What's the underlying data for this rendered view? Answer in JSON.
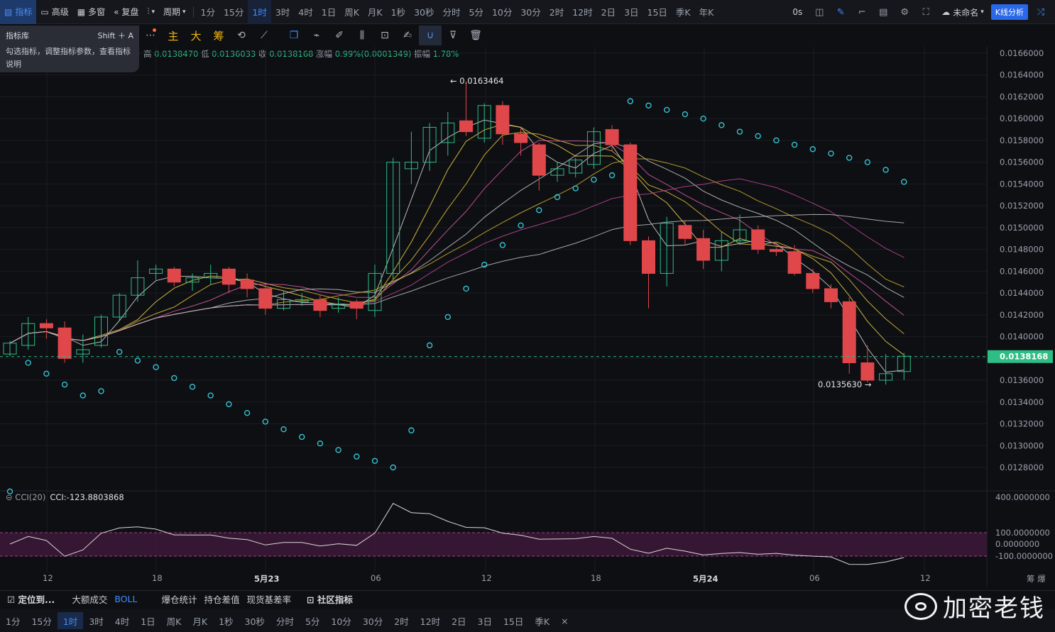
{
  "topbar": {
    "indicator": "指标",
    "advanced": "高级",
    "multi": "多窗",
    "replay": "复盘",
    "period": "周期",
    "timeframes": [
      "1分",
      "15分",
      "1时",
      "3时",
      "4时",
      "1日",
      "周K",
      "月K",
      "1秒",
      "30秒",
      "分时",
      "5分",
      "10分",
      "30分",
      "2时",
      "12时",
      "2日",
      "3日",
      "15日",
      "季K",
      "年K"
    ],
    "active_tf": "1时",
    "countdown": "0s",
    "layout_name": "未命名",
    "kline_btn": "K线分析"
  },
  "popup": {
    "title": "指标库",
    "shortcut": "Shift ＋ A",
    "desc": "勾选指标，调整指标参数，查看指标说明"
  },
  "drawbar": {
    "chars": [
      "主",
      "大",
      "筹"
    ]
  },
  "ohlc": {
    "high_label": "高",
    "high": "0.0138470",
    "low_label": "低",
    "low": "0.0136033",
    "close_label": "收",
    "close": "0.0138168",
    "chg_label": "涨幅",
    "chg": "0.99%(0.0001349)",
    "amp_label": "振幅",
    "amp": "1.78%"
  },
  "cci": {
    "label": "CCI(20)",
    "value": "CCI:-123.8803868"
  },
  "annotations": {
    "max": "← 0.0163464",
    "min": "0.0135630 →",
    "last_price": "0.0138168"
  },
  "colors": {
    "up": "#2dbd85",
    "down": "#e0474a",
    "bg": "#0e0f13",
    "accent": "#3f8cff",
    "sar": "#35c3d0",
    "last": "#2dbd85"
  },
  "chart_data": {
    "type": "candlestick",
    "price_ticks": [
      "0.0166000",
      "0.0164000",
      "0.0162000",
      "0.0160000",
      "0.0158000",
      "0.0156000",
      "0.0154000",
      "0.0152000",
      "0.0150000",
      "0.0148000",
      "0.0146000",
      "0.0144000",
      "0.0142000",
      "0.0140000",
      "0.0138000",
      "0.0136000",
      "0.0134000",
      "0.0132000",
      "0.0130000",
      "0.0128000"
    ],
    "cci_ticks": [
      "400.0000000",
      "100.0000000",
      "0.0000000",
      "-100.0000000"
    ],
    "x_labels": [
      {
        "t": "12",
        "b": false
      },
      {
        "t": "18",
        "b": false
      },
      {
        "t": "5月23",
        "b": true
      },
      {
        "t": "06",
        "b": false
      },
      {
        "t": "12",
        "b": false
      },
      {
        "t": "18",
        "b": false
      },
      {
        "t": "5月24",
        "b": true
      },
      {
        "t": "06",
        "b": false
      },
      {
        "t": "12",
        "b": false
      }
    ],
    "candles": [
      [
        0.01384,
        0.01394,
        0.01382,
        0.01396
      ],
      [
        0.01392,
        0.01412,
        0.01388,
        0.01418
      ],
      [
        0.01412,
        0.01408,
        0.01398,
        0.01416
      ],
      [
        0.01408,
        0.0138,
        0.01376,
        0.01414
      ],
      [
        0.01384,
        0.01388,
        0.01376,
        0.01402
      ],
      [
        0.01392,
        0.01418,
        0.0139,
        0.0142
      ],
      [
        0.01418,
        0.01438,
        0.01414,
        0.0144
      ],
      [
        0.01438,
        0.01454,
        0.01432,
        0.0147
      ],
      [
        0.01458,
        0.01462,
        0.01452,
        0.01466
      ],
      [
        0.01462,
        0.0145,
        0.01446,
        0.01464
      ],
      [
        0.0145,
        0.01454,
        0.01442,
        0.01458
      ],
      [
        0.01454,
        0.01458,
        0.01448,
        0.01466
      ],
      [
        0.01462,
        0.01448,
        0.0144,
        0.01464
      ],
      [
        0.01452,
        0.01444,
        0.01436,
        0.01458
      ],
      [
        0.01444,
        0.01426,
        0.0142,
        0.01448
      ],
      [
        0.01426,
        0.01434,
        0.01424,
        0.01442
      ],
      [
        0.01432,
        0.01434,
        0.01428,
        0.0144
      ],
      [
        0.01434,
        0.01424,
        0.01418,
        0.01438
      ],
      [
        0.01426,
        0.0143,
        0.01422,
        0.01436
      ],
      [
        0.01432,
        0.01426,
        0.01416,
        0.01434
      ],
      [
        0.01424,
        0.01458,
        0.01418,
        0.01466
      ],
      [
        0.01458,
        0.0156,
        0.01452,
        0.01564
      ],
      [
        0.01554,
        0.0156,
        0.0154,
        0.01588
      ],
      [
        0.0156,
        0.01592,
        0.01552,
        0.01596
      ],
      [
        0.01578,
        0.01596,
        0.01566,
        0.01606
      ],
      [
        0.01598,
        0.01588,
        0.01584,
        0.01634
      ],
      [
        0.01582,
        0.01612,
        0.01578,
        0.01614
      ],
      [
        0.01612,
        0.01586,
        0.01576,
        0.01616
      ],
      [
        0.01586,
        0.01578,
        0.01566,
        0.01592
      ],
      [
        0.01576,
        0.01548,
        0.01534,
        0.01578
      ],
      [
        0.01548,
        0.01554,
        0.01542,
        0.0156
      ],
      [
        0.0155,
        0.01562,
        0.01546,
        0.01564
      ],
      [
        0.01558,
        0.01588,
        0.01554,
        0.01592
      ],
      [
        0.0159,
        0.01576,
        0.0157,
        0.01594
      ],
      [
        0.01576,
        0.01488,
        0.01484,
        0.01578
      ],
      [
        0.01488,
        0.01458,
        0.01426,
        0.01492
      ],
      [
        0.01458,
        0.01504,
        0.01446,
        0.0151
      ],
      [
        0.01502,
        0.0149,
        0.01484,
        0.01506
      ],
      [
        0.0149,
        0.0147,
        0.01462,
        0.01498
      ],
      [
        0.0147,
        0.01488,
        0.0146,
        0.01496
      ],
      [
        0.01488,
        0.01498,
        0.01484,
        0.01512
      ],
      [
        0.01498,
        0.0148,
        0.01476,
        0.01502
      ],
      [
        0.0148,
        0.01478,
        0.01474,
        0.01482
      ],
      [
        0.01478,
        0.01458,
        0.01456,
        0.01484
      ],
      [
        0.01458,
        0.01444,
        0.0144,
        0.01462
      ],
      [
        0.01444,
        0.01432,
        0.01426,
        0.01448
      ],
      [
        0.01432,
        0.01376,
        0.01366,
        0.01436
      ],
      [
        0.01376,
        0.0136,
        0.01358,
        0.01392
      ],
      [
        0.0136,
        0.01366,
        0.01356,
        0.01384
      ],
      [
        0.01368,
        0.01382,
        0.0136,
        0.01385
      ]
    ],
    "sar": [
      0.01258,
      0.01376,
      0.01366,
      0.01356,
      0.01346,
      0.0135,
      0.01386,
      0.01378,
      0.01372,
      0.01362,
      0.01354,
      0.01346,
      0.01338,
      0.0133,
      0.01322,
      0.01315,
      0.01308,
      0.01302,
      0.01296,
      0.0129,
      0.01286,
      0.0128,
      0.01314,
      0.01392,
      0.01418,
      0.01444,
      0.01466,
      0.01484,
      0.01502,
      0.01516,
      0.01528,
      0.01536,
      0.01544,
      0.01548,
      0.01616,
      0.01612,
      0.01608,
      0.01604,
      0.016,
      0.01594,
      0.01588,
      0.01584,
      0.0158,
      0.01576,
      0.01572,
      0.01568,
      0.01564,
      0.0156,
      0.01553,
      0.01542
    ]
  }
}
